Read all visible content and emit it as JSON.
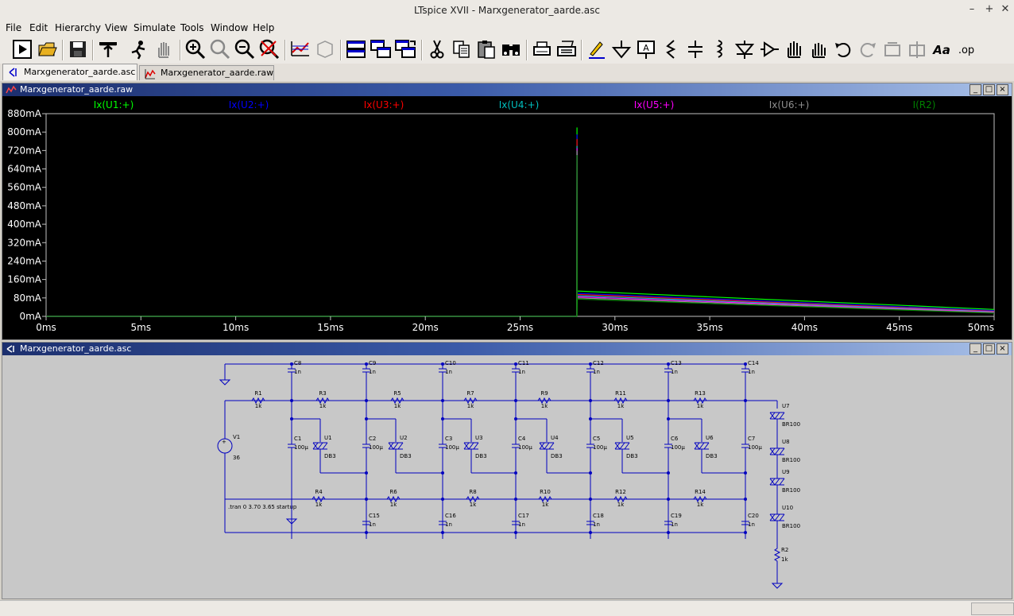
{
  "window": {
    "title": "LTspice XVII - Marxgenerator_aarde.asc",
    "btn_min": "–",
    "btn_max": "+",
    "btn_close": "✕"
  },
  "menu": [
    "File",
    "Edit",
    "Hierarchy",
    "View",
    "Simulate",
    "Tools",
    "Window",
    "Help"
  ],
  "toolbar": {
    "icons": [
      "run-icon",
      "open-icon",
      "save-icon",
      "control-panel-icon",
      "halt-icon",
      "pan-hand-icon",
      "zoom-in-icon",
      "zoom-full-icon",
      "zoom-out-icon",
      "zoom-cancel-icon",
      "autorange-icon",
      "fit-icon",
      "tile-horizontal-icon",
      "cascade-icon",
      "tile-vertical-icon",
      "cut-icon",
      "copy-icon",
      "paste-icon",
      "find-icon",
      "print-preview-icon",
      "print-icon",
      "draw-wire-icon",
      "ground-icon",
      "label-net-icon",
      "resistor-icon",
      "capacitor-icon",
      "inductor-icon",
      "diode-icon",
      "component-icon",
      "move-icon",
      "drag-icon",
      "undo-icon",
      "redo-icon",
      "rotate-icon",
      "mirror-icon",
      "text-icon",
      "spice-directive-icon"
    ],
    "spice_directive_label": ".op",
    "text_label": "Aa"
  },
  "tabs": [
    {
      "label": "Marxgenerator_aarde.asc",
      "icon": "schematic-icon",
      "active": true
    },
    {
      "label": "Marxgenerator_aarde.raw",
      "icon": "waveform-icon",
      "active": false
    }
  ],
  "plot_pane": {
    "title": "Marxgenerator_aarde.raw"
  },
  "schematic_pane": {
    "title": "Marxgenerator_aarde.asc"
  },
  "chart_data": {
    "type": "line",
    "title": "",
    "xlabel": "",
    "ylabel": "",
    "xlim": [
      0,
      50
    ],
    "ylim": [
      0,
      880
    ],
    "x_unit": "ms",
    "y_unit": "mA",
    "xticks": [
      "0ms",
      "5ms",
      "10ms",
      "15ms",
      "20ms",
      "25ms",
      "30ms",
      "35ms",
      "40ms",
      "45ms",
      "50ms"
    ],
    "yticks": [
      "0mA",
      "80mA",
      "160mA",
      "240mA",
      "320mA",
      "400mA",
      "480mA",
      "560mA",
      "640mA",
      "720mA",
      "800mA",
      "880mA"
    ],
    "grid": false,
    "legend_position": "top",
    "series": [
      {
        "name": "Ix(U1:+)",
        "color": "#00ff00",
        "x": [
          0,
          27.99,
          28.0,
          28.0,
          28.01,
          50
        ],
        "y": [
          0,
          0,
          820,
          0,
          110,
          30
        ]
      },
      {
        "name": "Ix(U2:+)",
        "color": "#0000ff",
        "x": [
          0,
          27.99,
          28.0,
          28.01,
          50
        ],
        "y": [
          0,
          0,
          790,
          100,
          25
        ]
      },
      {
        "name": "Ix(U3:+)",
        "color": "#ff0000",
        "x": [
          0,
          27.99,
          28.0,
          28.01,
          50
        ],
        "y": [
          0,
          0,
          770,
          95,
          22
        ]
      },
      {
        "name": "Ix(U4:+)",
        "color": "#00c0c0",
        "x": [
          0,
          27.99,
          28.0,
          28.01,
          50
        ],
        "y": [
          0,
          0,
          740,
          90,
          20
        ]
      },
      {
        "name": "Ix(U5:+)",
        "color": "#ff00ff",
        "x": [
          0,
          27.99,
          28.0,
          28.01,
          50
        ],
        "y": [
          0,
          0,
          730,
          85,
          18
        ]
      },
      {
        "name": "Ix(U6:+)",
        "color": "#909090",
        "x": [
          0,
          27.99,
          28.0,
          28.01,
          50
        ],
        "y": [
          0,
          0,
          720,
          80,
          16
        ]
      },
      {
        "name": "I(R2)",
        "color": "#008000",
        "x": [
          0,
          27.99,
          28.0,
          28.01,
          50
        ],
        "y": [
          0,
          0,
          700,
          75,
          14
        ]
      }
    ]
  },
  "schematic": {
    "directive": ".tran 0 3.70 3.65 startup",
    "source": {
      "ref": "V1",
      "value": "36"
    },
    "top_caps": [
      [
        "C8",
        "1n"
      ],
      [
        "C9",
        "1n"
      ],
      [
        "C10",
        "1n"
      ],
      [
        "C11",
        "1n"
      ],
      [
        "C12",
        "1n"
      ],
      [
        "C13",
        "1n"
      ],
      [
        "C14",
        "1n"
      ]
    ],
    "top_res": [
      [
        "R1",
        "1k"
      ],
      [
        "R3",
        "1k"
      ],
      [
        "R5",
        "1k"
      ],
      [
        "R7",
        "1k"
      ],
      [
        "R9",
        "1k"
      ],
      [
        "R11",
        "1k"
      ],
      [
        "R13",
        "1k"
      ]
    ],
    "main_caps": [
      [
        "C1",
        "100µ"
      ],
      [
        "C2",
        "100µ"
      ],
      [
        "C3",
        "100µ"
      ],
      [
        "C4",
        "100µ"
      ],
      [
        "C5",
        "100µ"
      ],
      [
        "C6",
        "100µ"
      ],
      [
        "C7",
        "100µ"
      ]
    ],
    "diacs": [
      [
        "U1",
        "DB3"
      ],
      [
        "U2",
        "DB3"
      ],
      [
        "U3",
        "DB3"
      ],
      [
        "U4",
        "DB3"
      ],
      [
        "U5",
        "DB3"
      ],
      [
        "U6",
        "DB3"
      ]
    ],
    "bot_res": [
      [
        "R4",
        "1k"
      ],
      [
        "R6",
        "1k"
      ],
      [
        "R8",
        "1k"
      ],
      [
        "R10",
        "1k"
      ],
      [
        "R12",
        "1k"
      ],
      [
        "R14",
        "1k"
      ]
    ],
    "bot_caps": [
      [
        "C15",
        "1n"
      ],
      [
        "C16",
        "1n"
      ],
      [
        "C17",
        "1n"
      ],
      [
        "C18",
        "1n"
      ],
      [
        "C19",
        "1n"
      ],
      [
        "C20",
        "1n"
      ]
    ],
    "breakovers": [
      [
        "U7",
        "BR100"
      ],
      [
        "U8",
        "BR100"
      ],
      [
        "U9",
        "BR100"
      ],
      [
        "U10",
        "BR100"
      ]
    ],
    "load": {
      "ref": "R2",
      "value": "1k"
    }
  }
}
